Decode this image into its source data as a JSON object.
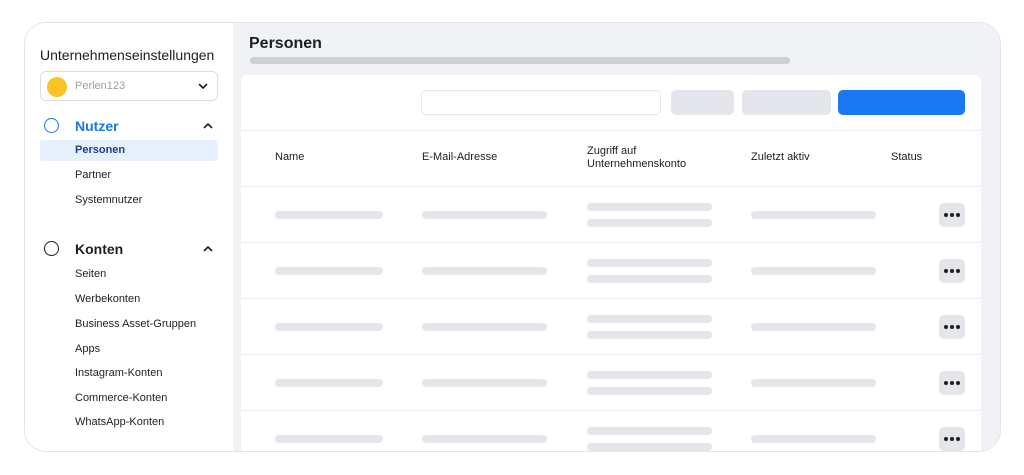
{
  "sidebar": {
    "title": "Unternehmenseinstellungen",
    "account": {
      "name": "Perlen123",
      "dot_color": "#f7c325"
    },
    "sections": [
      {
        "label": "Nutzer",
        "icon": "circle-outline-icon",
        "items": [
          "Personen",
          "Partner",
          "Systemnutzer"
        ]
      },
      {
        "label": "Konten",
        "icon": "circle-outline-icon",
        "items": [
          "Seiten",
          "Werbekonten",
          "Business Asset-Gruppen",
          "Apps",
          "Instagram-Konten",
          "Commerce-Konten",
          "WhatsApp-Konten"
        ]
      }
    ],
    "active_item": "Personen"
  },
  "main": {
    "title": "Personen",
    "search": {
      "placeholder": ""
    },
    "table": {
      "headers": {
        "name": "Name",
        "email": "E-Mail-Adresse",
        "access_line1": "Zugriff auf",
        "access_line2": "Unternehmenskonto",
        "last_active": "Zuletzt aktiv",
        "status": "Status"
      },
      "row_count": 5
    }
  },
  "colors": {
    "accent": "#1877f2",
    "placeholder": "#e4e6eb",
    "background": "#f0f2f5"
  }
}
